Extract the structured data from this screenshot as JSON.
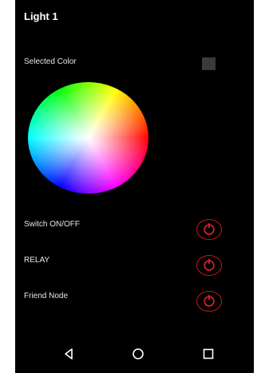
{
  "screen": {
    "title": "Light 1"
  },
  "selected_color": {
    "label": "Selected Color",
    "value_color": "#3a3a3a"
  },
  "controls": [
    {
      "label": "Switch ON/OFF",
      "icon": "power-icon"
    },
    {
      "label": "RELAY",
      "icon": "power-icon"
    },
    {
      "label": "Friend Node",
      "icon": "power-icon"
    }
  ],
  "colors": {
    "background": "#000000",
    "accent_red": "#c81818",
    "text": "#ffffff"
  },
  "navigation": {
    "icons": [
      "back-triangle-icon",
      "home-circle-icon",
      "recents-square-icon"
    ]
  }
}
